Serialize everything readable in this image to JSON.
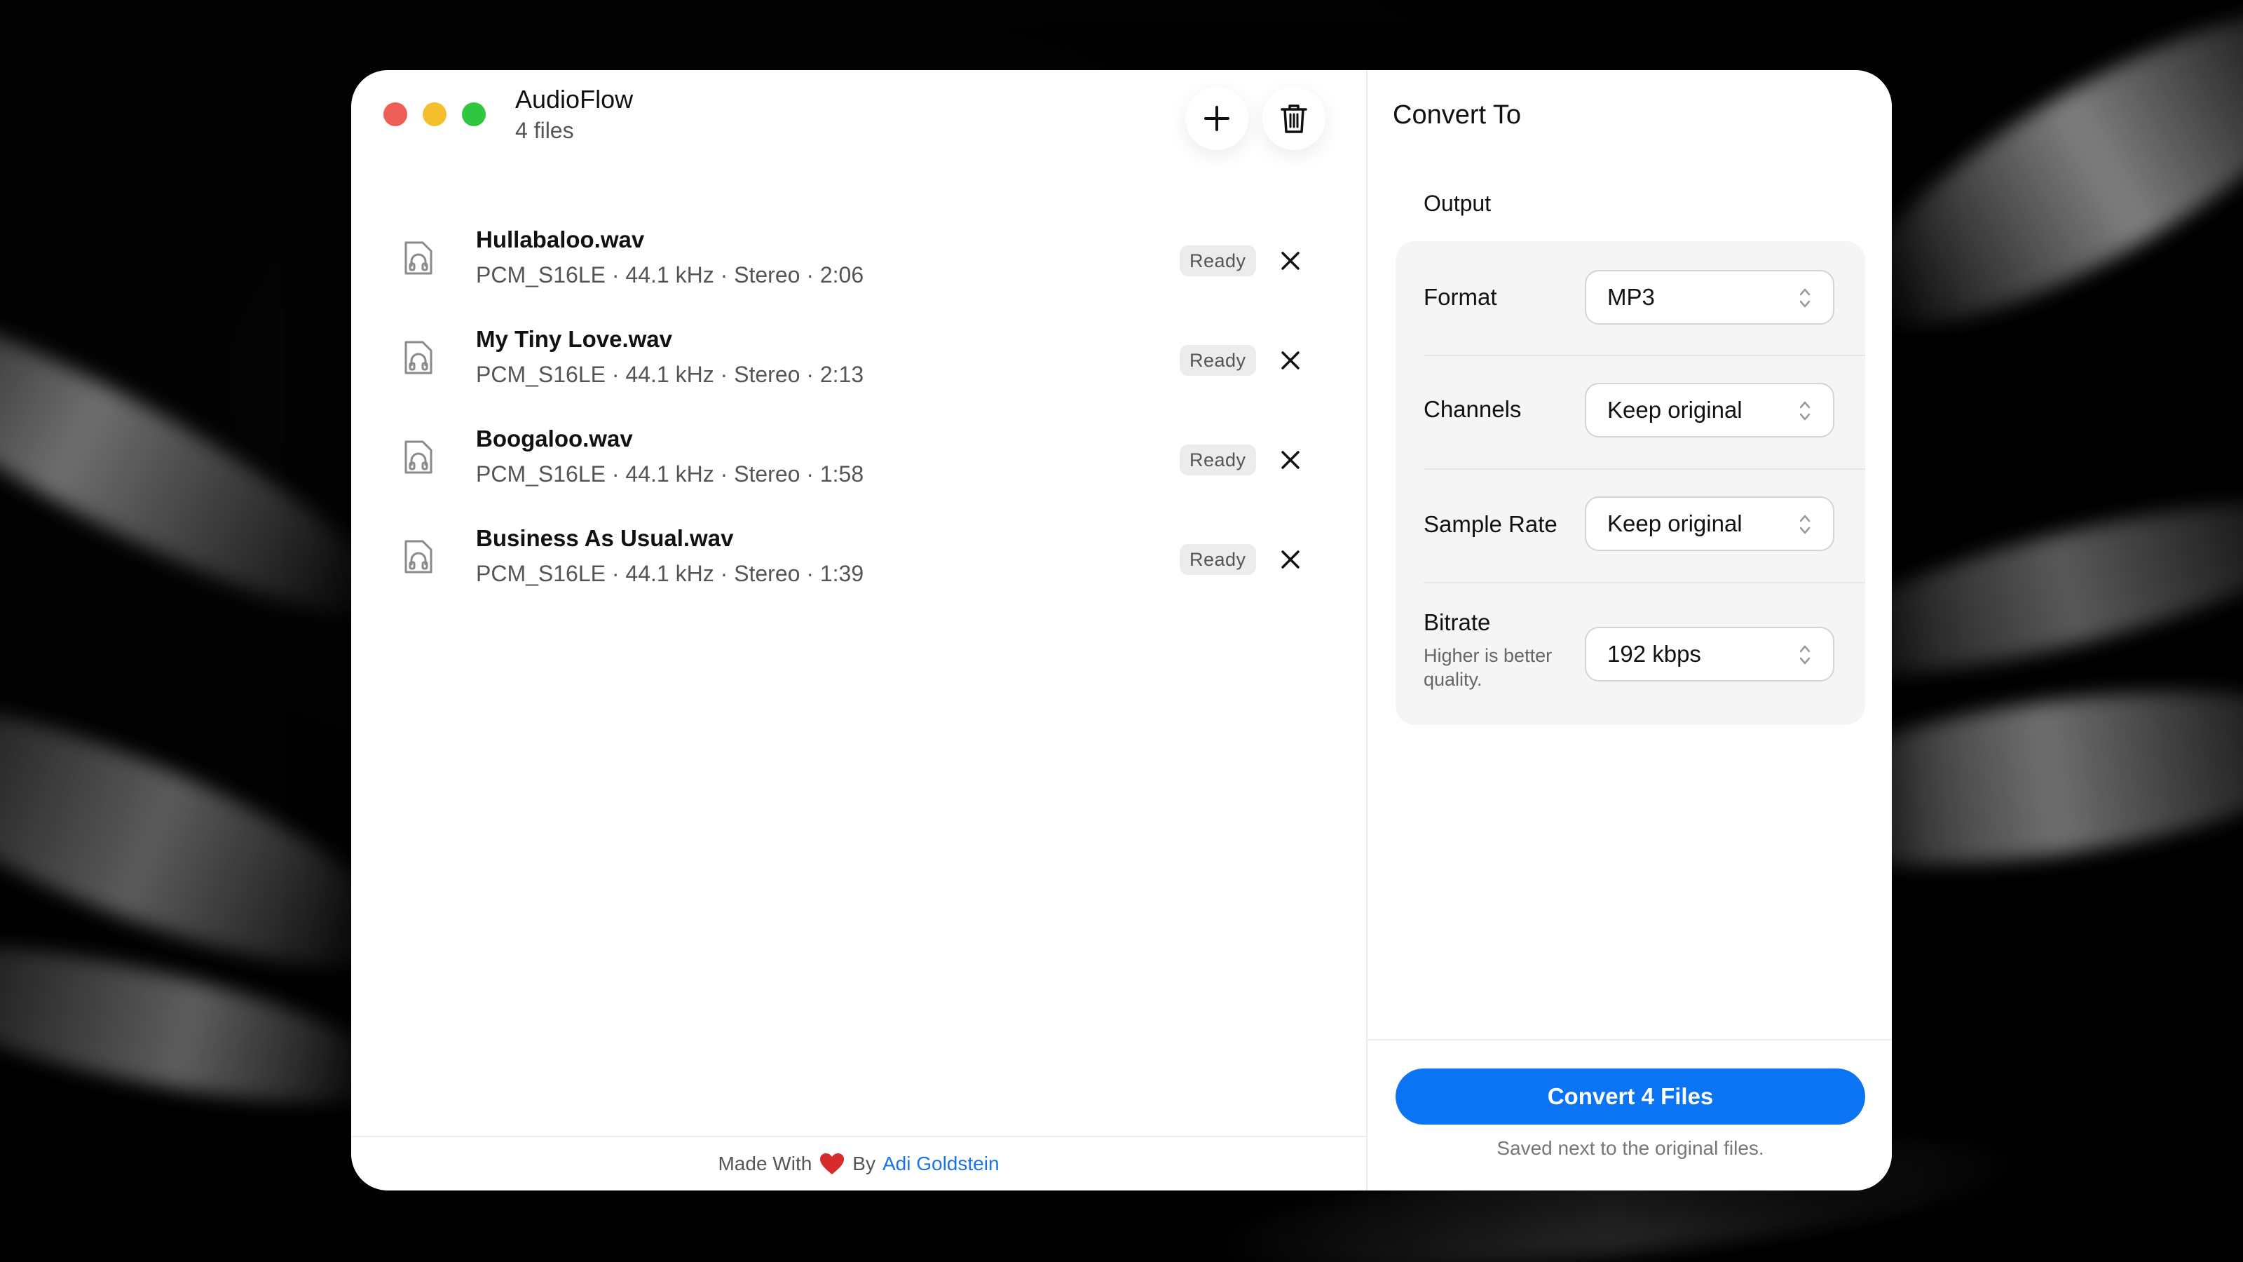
{
  "window": {
    "title": "AudioFlow",
    "subtitle": "4 files"
  },
  "toolbar": {
    "add_icon": "plus-icon",
    "delete_icon": "trash-icon"
  },
  "files": [
    {
      "name": "Hullabaloo.wav",
      "meta": "PCM_S16LE · 44.1 kHz · Stereo · 2:06",
      "status": "Ready"
    },
    {
      "name": "My Tiny Love.wav",
      "meta": "PCM_S16LE · 44.1 kHz · Stereo · 2:13",
      "status": "Ready"
    },
    {
      "name": "Boogaloo.wav",
      "meta": "PCM_S16LE · 44.1 kHz · Stereo · 1:58",
      "status": "Ready"
    },
    {
      "name": "Business As Usual.wav",
      "meta": "PCM_S16LE · 44.1 kHz · Stereo · 1:39",
      "status": "Ready"
    }
  ],
  "footer": {
    "made_with": "Made With",
    "by": "By",
    "author": "Adi Goldstein"
  },
  "panel": {
    "title": "Convert To",
    "section": "Output",
    "settings": {
      "format": {
        "label": "Format",
        "value": "MP3"
      },
      "channels": {
        "label": "Channels",
        "value": "Keep original"
      },
      "sample_rate": {
        "label": "Sample Rate",
        "value": "Keep original"
      },
      "bitrate": {
        "label": "Bitrate",
        "help": "Higher is better quality.",
        "value": "192 kbps"
      }
    },
    "convert_button": "Convert 4 Files",
    "saved_note": "Saved next to the original files."
  },
  "colors": {
    "accent": "#0a74f5",
    "close": "#ed5f57",
    "minimize": "#f5be2d",
    "zoom": "#2fc740",
    "heart": "#d62b2b",
    "link": "#1a73e8"
  }
}
